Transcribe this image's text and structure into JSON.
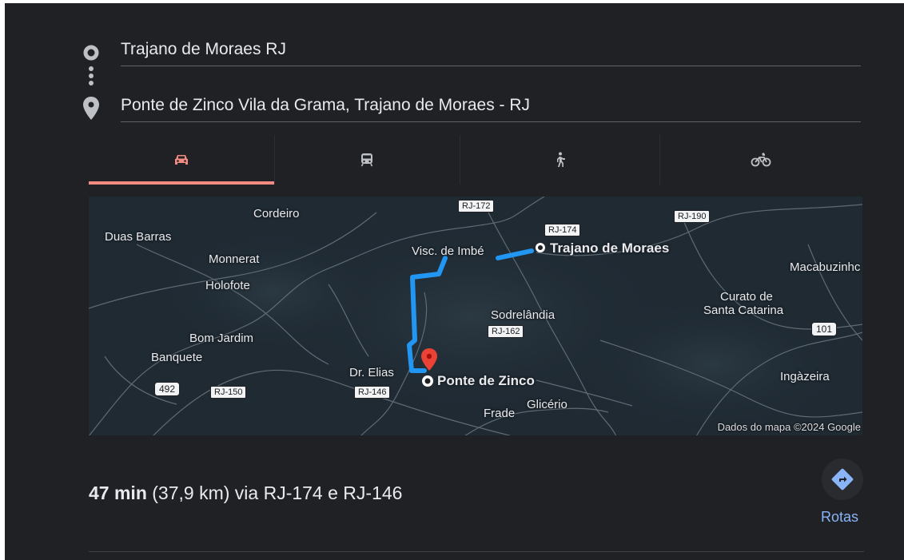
{
  "route": {
    "origin": "Trajano de Moraes RJ",
    "destination": "Ponte de Zinco Vila da Grama, Trajano de Moraes - RJ",
    "origin_icon": "origin-circle-icon",
    "destination_icon": "location-pin-icon"
  },
  "modes": {
    "items": [
      {
        "name": "car",
        "icon": "car-icon",
        "active": true
      },
      {
        "name": "transit",
        "icon": "train-icon",
        "active": false
      },
      {
        "name": "walking",
        "icon": "walking-icon",
        "active": false
      },
      {
        "name": "cycling",
        "icon": "bicycle-icon",
        "active": false
      }
    ],
    "active_color": "#f28b82"
  },
  "map": {
    "places": {
      "cordeiro": "Cordeiro",
      "duas_barras": "Duas Barras",
      "monnerat": "Monnerat",
      "holofote": "Holofote",
      "visc_imbe": "Visc. de Imbé",
      "trajano": "Trajano de Moraes",
      "macabuzinho": "Macabuzinhc",
      "curato": "Curato de",
      "santa_catarina": "Santa Catarina",
      "sodrelandia": "Sodrelândia",
      "bom_jardim": "Bom Jardim",
      "banquete": "Banquete",
      "dr_elias": "Dr. Elias",
      "ponte_zinco": "Ponte de Zinco",
      "ingazeira": "Ingàzeira",
      "glicerio": "Glicério",
      "frade": "Frade"
    },
    "shields": {
      "rj172": "RJ-172",
      "rj174": "RJ-174",
      "rj190": "RJ-190",
      "rj162": "RJ-162",
      "r101": "101",
      "r492": "492",
      "rj150": "RJ-150",
      "rj146": "RJ-146"
    },
    "credit": "Dados do mapa ©2024 Google",
    "route_color": "#2196f3",
    "pin_color": "#ea4335"
  },
  "summary": {
    "duration": "47 min",
    "details": " (37,9 km) via RJ-174 e RJ-146"
  },
  "actions": {
    "rotas_label": "Rotas",
    "rotas_icon": "directions-icon"
  }
}
